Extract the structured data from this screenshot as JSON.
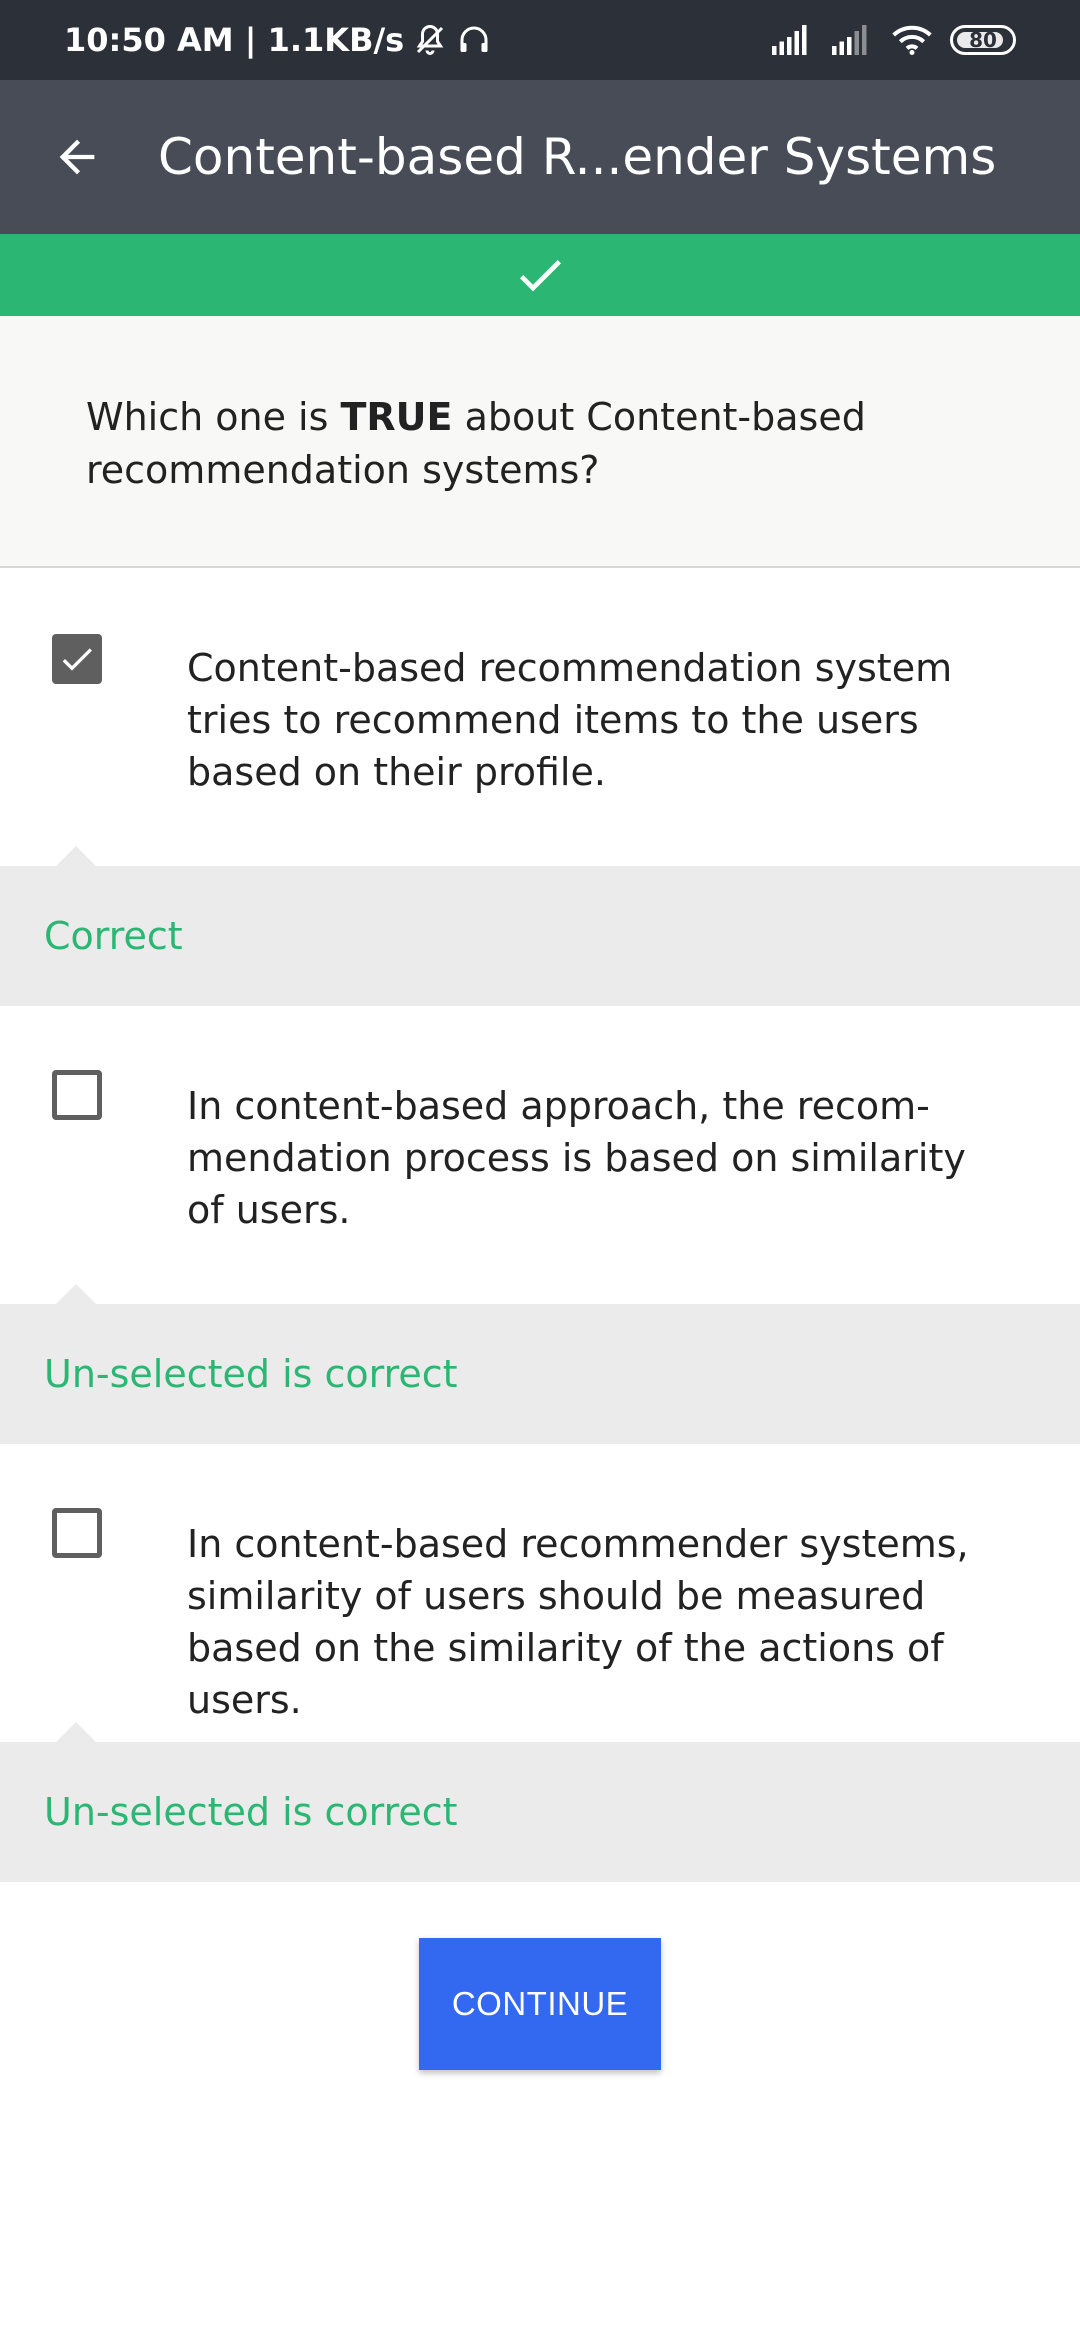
{
  "status_bar": {
    "time_speed": "10:50 AM | 1.1KB/s",
    "battery": "80",
    "icons": [
      "mute-bell-icon",
      "headset-icon",
      "signal-icon",
      "signal-icon",
      "wifi-icon",
      "battery-icon"
    ]
  },
  "app_bar": {
    "title": "Content-based R...ender Systems",
    "back_icon": "arrow-left-icon"
  },
  "banner": {
    "icon": "check-icon",
    "color": "#2bb673"
  },
  "question": {
    "prefix": "Which one is ",
    "emphasis": "TRUE",
    "suffix": " about Content-based recommendation systems?"
  },
  "options": [
    {
      "text": "Content-based recommendation system tries to recommend items to the users based on their profile.",
      "checked": true,
      "feedback": "Correct"
    },
    {
      "text": "In content-based approach, the recom­mendation process is based on similarity of users.",
      "checked": false,
      "feedback": "Un-selected is correct"
    },
    {
      "text": "In content-based recommender systems, similarity of users should be measured based on the similarity of the actions of users.",
      "checked": false,
      "feedback": "Un-selected is correct"
    }
  ],
  "continue": {
    "label": "CONTINUE",
    "color": "#3368f0"
  }
}
